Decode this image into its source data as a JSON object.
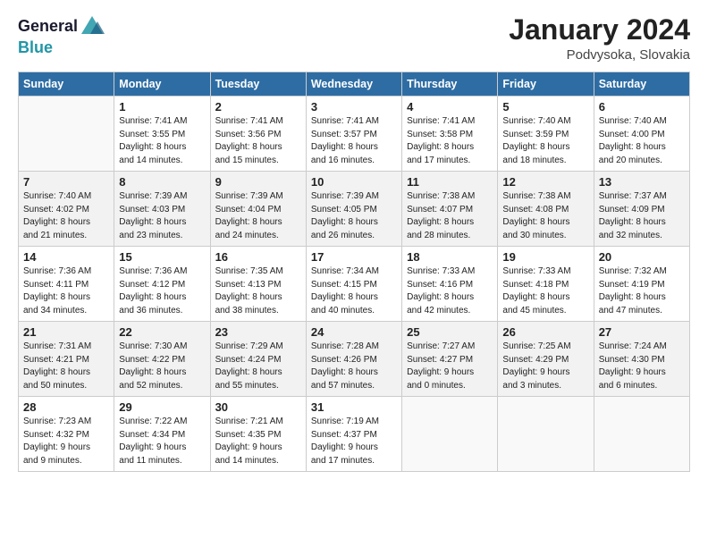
{
  "logo": {
    "line1": "General",
    "line2": "Blue"
  },
  "title": "January 2024",
  "subtitle": "Podvysoka, Slovakia",
  "weekdays": [
    "Sunday",
    "Monday",
    "Tuesday",
    "Wednesday",
    "Thursday",
    "Friday",
    "Saturday"
  ],
  "weeks": [
    [
      {
        "day": "",
        "info": ""
      },
      {
        "day": "1",
        "info": "Sunrise: 7:41 AM\nSunset: 3:55 PM\nDaylight: 8 hours\nand 14 minutes."
      },
      {
        "day": "2",
        "info": "Sunrise: 7:41 AM\nSunset: 3:56 PM\nDaylight: 8 hours\nand 15 minutes."
      },
      {
        "day": "3",
        "info": "Sunrise: 7:41 AM\nSunset: 3:57 PM\nDaylight: 8 hours\nand 16 minutes."
      },
      {
        "day": "4",
        "info": "Sunrise: 7:41 AM\nSunset: 3:58 PM\nDaylight: 8 hours\nand 17 minutes."
      },
      {
        "day": "5",
        "info": "Sunrise: 7:40 AM\nSunset: 3:59 PM\nDaylight: 8 hours\nand 18 minutes."
      },
      {
        "day": "6",
        "info": "Sunrise: 7:40 AM\nSunset: 4:00 PM\nDaylight: 8 hours\nand 20 minutes."
      }
    ],
    [
      {
        "day": "7",
        "info": "Sunrise: 7:40 AM\nSunset: 4:02 PM\nDaylight: 8 hours\nand 21 minutes."
      },
      {
        "day": "8",
        "info": "Sunrise: 7:39 AM\nSunset: 4:03 PM\nDaylight: 8 hours\nand 23 minutes."
      },
      {
        "day": "9",
        "info": "Sunrise: 7:39 AM\nSunset: 4:04 PM\nDaylight: 8 hours\nand 24 minutes."
      },
      {
        "day": "10",
        "info": "Sunrise: 7:39 AM\nSunset: 4:05 PM\nDaylight: 8 hours\nand 26 minutes."
      },
      {
        "day": "11",
        "info": "Sunrise: 7:38 AM\nSunset: 4:07 PM\nDaylight: 8 hours\nand 28 minutes."
      },
      {
        "day": "12",
        "info": "Sunrise: 7:38 AM\nSunset: 4:08 PM\nDaylight: 8 hours\nand 30 minutes."
      },
      {
        "day": "13",
        "info": "Sunrise: 7:37 AM\nSunset: 4:09 PM\nDaylight: 8 hours\nand 32 minutes."
      }
    ],
    [
      {
        "day": "14",
        "info": "Sunrise: 7:36 AM\nSunset: 4:11 PM\nDaylight: 8 hours\nand 34 minutes."
      },
      {
        "day": "15",
        "info": "Sunrise: 7:36 AM\nSunset: 4:12 PM\nDaylight: 8 hours\nand 36 minutes."
      },
      {
        "day": "16",
        "info": "Sunrise: 7:35 AM\nSunset: 4:13 PM\nDaylight: 8 hours\nand 38 minutes."
      },
      {
        "day": "17",
        "info": "Sunrise: 7:34 AM\nSunset: 4:15 PM\nDaylight: 8 hours\nand 40 minutes."
      },
      {
        "day": "18",
        "info": "Sunrise: 7:33 AM\nSunset: 4:16 PM\nDaylight: 8 hours\nand 42 minutes."
      },
      {
        "day": "19",
        "info": "Sunrise: 7:33 AM\nSunset: 4:18 PM\nDaylight: 8 hours\nand 45 minutes."
      },
      {
        "day": "20",
        "info": "Sunrise: 7:32 AM\nSunset: 4:19 PM\nDaylight: 8 hours\nand 47 minutes."
      }
    ],
    [
      {
        "day": "21",
        "info": "Sunrise: 7:31 AM\nSunset: 4:21 PM\nDaylight: 8 hours\nand 50 minutes."
      },
      {
        "day": "22",
        "info": "Sunrise: 7:30 AM\nSunset: 4:22 PM\nDaylight: 8 hours\nand 52 minutes."
      },
      {
        "day": "23",
        "info": "Sunrise: 7:29 AM\nSunset: 4:24 PM\nDaylight: 8 hours\nand 55 minutes."
      },
      {
        "day": "24",
        "info": "Sunrise: 7:28 AM\nSunset: 4:26 PM\nDaylight: 8 hours\nand 57 minutes."
      },
      {
        "day": "25",
        "info": "Sunrise: 7:27 AM\nSunset: 4:27 PM\nDaylight: 9 hours\nand 0 minutes."
      },
      {
        "day": "26",
        "info": "Sunrise: 7:25 AM\nSunset: 4:29 PM\nDaylight: 9 hours\nand 3 minutes."
      },
      {
        "day": "27",
        "info": "Sunrise: 7:24 AM\nSunset: 4:30 PM\nDaylight: 9 hours\nand 6 minutes."
      }
    ],
    [
      {
        "day": "28",
        "info": "Sunrise: 7:23 AM\nSunset: 4:32 PM\nDaylight: 9 hours\nand 9 minutes."
      },
      {
        "day": "29",
        "info": "Sunrise: 7:22 AM\nSunset: 4:34 PM\nDaylight: 9 hours\nand 11 minutes."
      },
      {
        "day": "30",
        "info": "Sunrise: 7:21 AM\nSunset: 4:35 PM\nDaylight: 9 hours\nand 14 minutes."
      },
      {
        "day": "31",
        "info": "Sunrise: 7:19 AM\nSunset: 4:37 PM\nDaylight: 9 hours\nand 17 minutes."
      },
      {
        "day": "",
        "info": ""
      },
      {
        "day": "",
        "info": ""
      },
      {
        "day": "",
        "info": ""
      }
    ]
  ]
}
